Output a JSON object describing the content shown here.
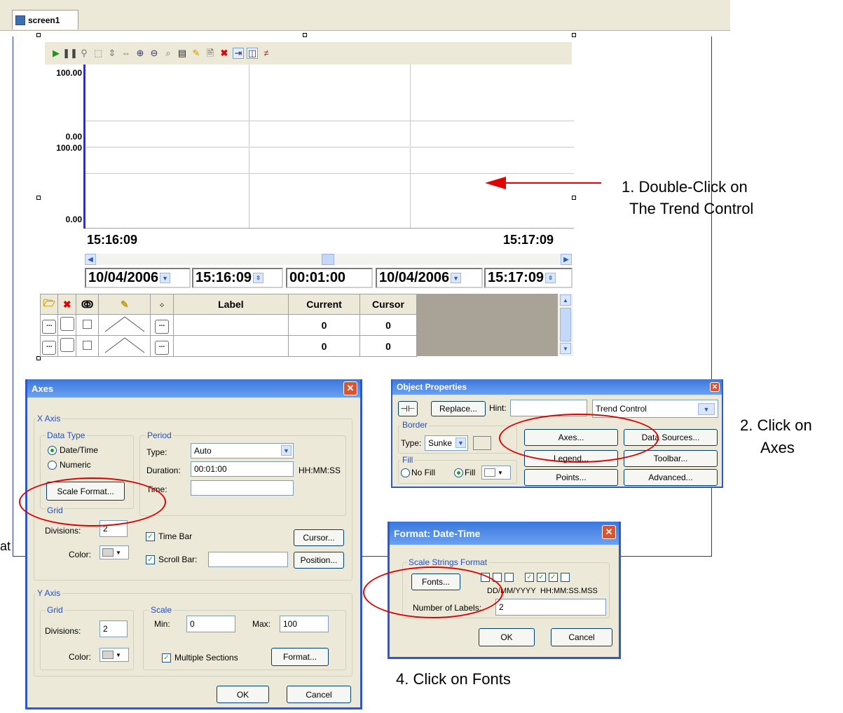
{
  "tab": {
    "label": "screen1"
  },
  "trend": {
    "y_top": "100.00",
    "y_mid_low": "0.00",
    "y_mid_high": "100.00",
    "y_bottom": "0.00",
    "time_start": "15:16:09",
    "time_end": "15:17:09",
    "start_date": "10/04/2006",
    "start_time": "15:16:09",
    "duration": "00:01:00",
    "end_date": "10/04/2006",
    "end_time": "15:17:09",
    "legend_headers": [
      "Label",
      "Current",
      "Cursor"
    ],
    "legend_rows": [
      {
        "current": "0",
        "cursor": "0"
      },
      {
        "current": "0",
        "cursor": "0"
      }
    ]
  },
  "axes_dialog": {
    "title": "Axes",
    "x_axis": "X Axis",
    "data_type": "Data Type",
    "date_time": "Date/Time",
    "numeric": "Numeric",
    "scale_format": "Scale Format...",
    "period": "Period",
    "type_label": "Type:",
    "type_value": "Auto",
    "duration_label": "Duration:",
    "duration_value": "00:01:00",
    "duration_unit": "HH:MM:SS",
    "time_label": "Time:",
    "time_value": "",
    "grid": "Grid",
    "divisions_label": "Divisions:",
    "x_divisions": "2",
    "color_label": "Color:",
    "time_bar": "Time Bar",
    "scroll_bar": "Scroll Bar:",
    "scroll_value": "",
    "cursor": "Cursor...",
    "position": "Position...",
    "y_axis": "Y Axis",
    "y_grid": "Grid",
    "y_divisions": "2",
    "scale": "Scale",
    "min_label": "Min:",
    "min_value": "0",
    "max_label": "Max:",
    "max_value": "100",
    "multiple_sections": "Multiple Sections",
    "format": "Format...",
    "ok": "OK",
    "cancel": "Cancel"
  },
  "object_props": {
    "title": "Object Properties",
    "replace": "Replace...",
    "hint_label": "Hint:",
    "hint_value": "",
    "object_type": "Trend Control",
    "border": "Border",
    "type_label": "Type:",
    "border_type": "Sunke",
    "fill": "Fill",
    "no_fill": "No Fill",
    "fill_opt": "Fill",
    "axes": "Axes...",
    "data_sources": "Data Sources...",
    "legend": "Legend...",
    "toolbar": "Toolbar...",
    "points": "Points...",
    "advanced": "Advanced..."
  },
  "format_dialog": {
    "title": "Format: Date-Time",
    "group": "Scale Strings Format",
    "fonts": "Fonts...",
    "date_fmt": "DD/MM/YYYY",
    "time_fmt": "HH:MM:SS.MSS",
    "num_labels_label": "Number of Labels:",
    "num_labels_value": "2",
    "ok": "OK",
    "cancel": "Cancel"
  },
  "notes": {
    "step1_line1": "1. Double-Click on",
    "step1_line2": "The Trend Control",
    "step2_line1": "2. Click on",
    "step2_line2": "Axes",
    "step3_fragment": "at",
    "step4": "4. Click on Fonts"
  },
  "colors": {
    "annotation": "#e00000",
    "title_bar": "#3b78dd",
    "axis_line": "#2a2ae0"
  }
}
